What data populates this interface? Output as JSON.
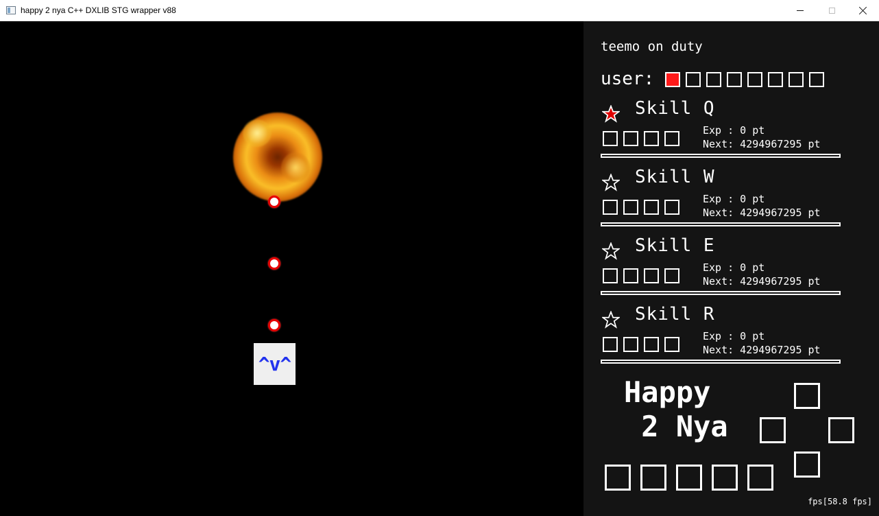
{
  "window": {
    "title": "happy 2 nya C++ DXLIB STG wrapper v88",
    "icon": "app-window-icon",
    "controls": [
      "minimize-icon",
      "maximize-icon",
      "close-icon"
    ]
  },
  "game": {
    "player_face": "^v^",
    "colors": {
      "background": "#000000",
      "bullet_ring": "#e60000",
      "player_text": "#2233ee"
    }
  },
  "sidebar": {
    "heading": "teemo on duty",
    "user_label": "user:",
    "user_slots": {
      "total": 8,
      "active": 1
    },
    "skills": [
      {
        "name": "Skill Q",
        "star": "★",
        "star_filled": true,
        "exp": "Exp : 0 pt",
        "next": "Next: 4294967295 pt"
      },
      {
        "name": "Skill W",
        "star": "☆",
        "star_filled": false,
        "exp": "Exp : 0 pt",
        "next": "Next: 4294967295 pt"
      },
      {
        "name": "Skill E",
        "star": "☆",
        "star_filled": false,
        "exp": "Exp : 0 pt",
        "next": "Next: 4294967295 pt"
      },
      {
        "name": "Skill R",
        "star": "☆",
        "star_filled": false,
        "exp": "Exp : 0 pt",
        "next": "Next: 4294967295 pt"
      }
    ],
    "logo": {
      "line1": "Happy",
      "line2": " 2 Nya"
    },
    "fps": "fps[58.8 fps]",
    "colors": {
      "panel": "#141414",
      "active_slot": "#ff1a1a",
      "star_fill": "#e00000"
    }
  }
}
